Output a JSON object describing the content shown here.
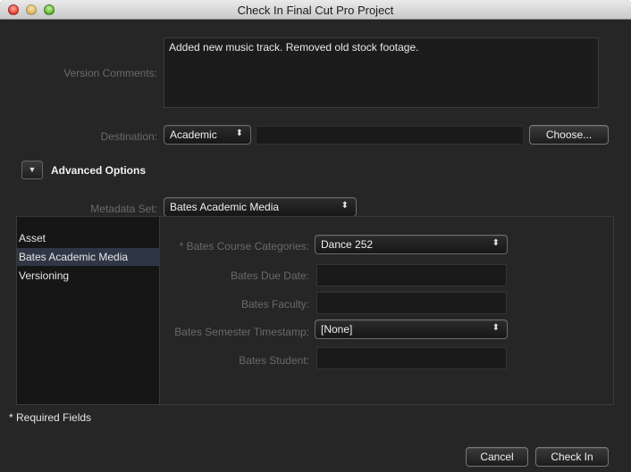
{
  "window": {
    "title": "Check In Final Cut Pro Project"
  },
  "form": {
    "version_comments_label": "Version Comments:",
    "version_comments_value": "Added new music track. Removed old stock footage.",
    "destination_label": "Destination:",
    "destination_value": "Academic",
    "choose_button": "Choose...",
    "advanced_options_label": "Advanced Options",
    "metadata_set_label": "Metadata Set:",
    "metadata_set_value": "Bates Academic Media"
  },
  "sidebar": {
    "items": [
      {
        "label": "Asset",
        "selected": false
      },
      {
        "label": "Bates Academic Media",
        "selected": true
      },
      {
        "label": "Versioning",
        "selected": false
      }
    ]
  },
  "metadata": {
    "course_categories_label": "* Bates Course Categories:",
    "course_categories_value": "Dance 252",
    "due_date_label": "Bates Due Date:",
    "due_date_value": "",
    "faculty_label": "Bates Faculty:",
    "faculty_value": "",
    "semester_timestamp_label": "Bates Semester Timestamp:",
    "semester_timestamp_value": "[None]",
    "student_label": "Bates Student:",
    "student_value": ""
  },
  "footer": {
    "required_note": "* Required Fields",
    "cancel_button": "Cancel",
    "checkin_button": "Check In"
  },
  "icons": {
    "popup_arrows": "⬍",
    "disclosure": "▼"
  },
  "colors": {
    "background": "#262626",
    "selection": "#2f3747",
    "label": "#6a6a6a"
  }
}
